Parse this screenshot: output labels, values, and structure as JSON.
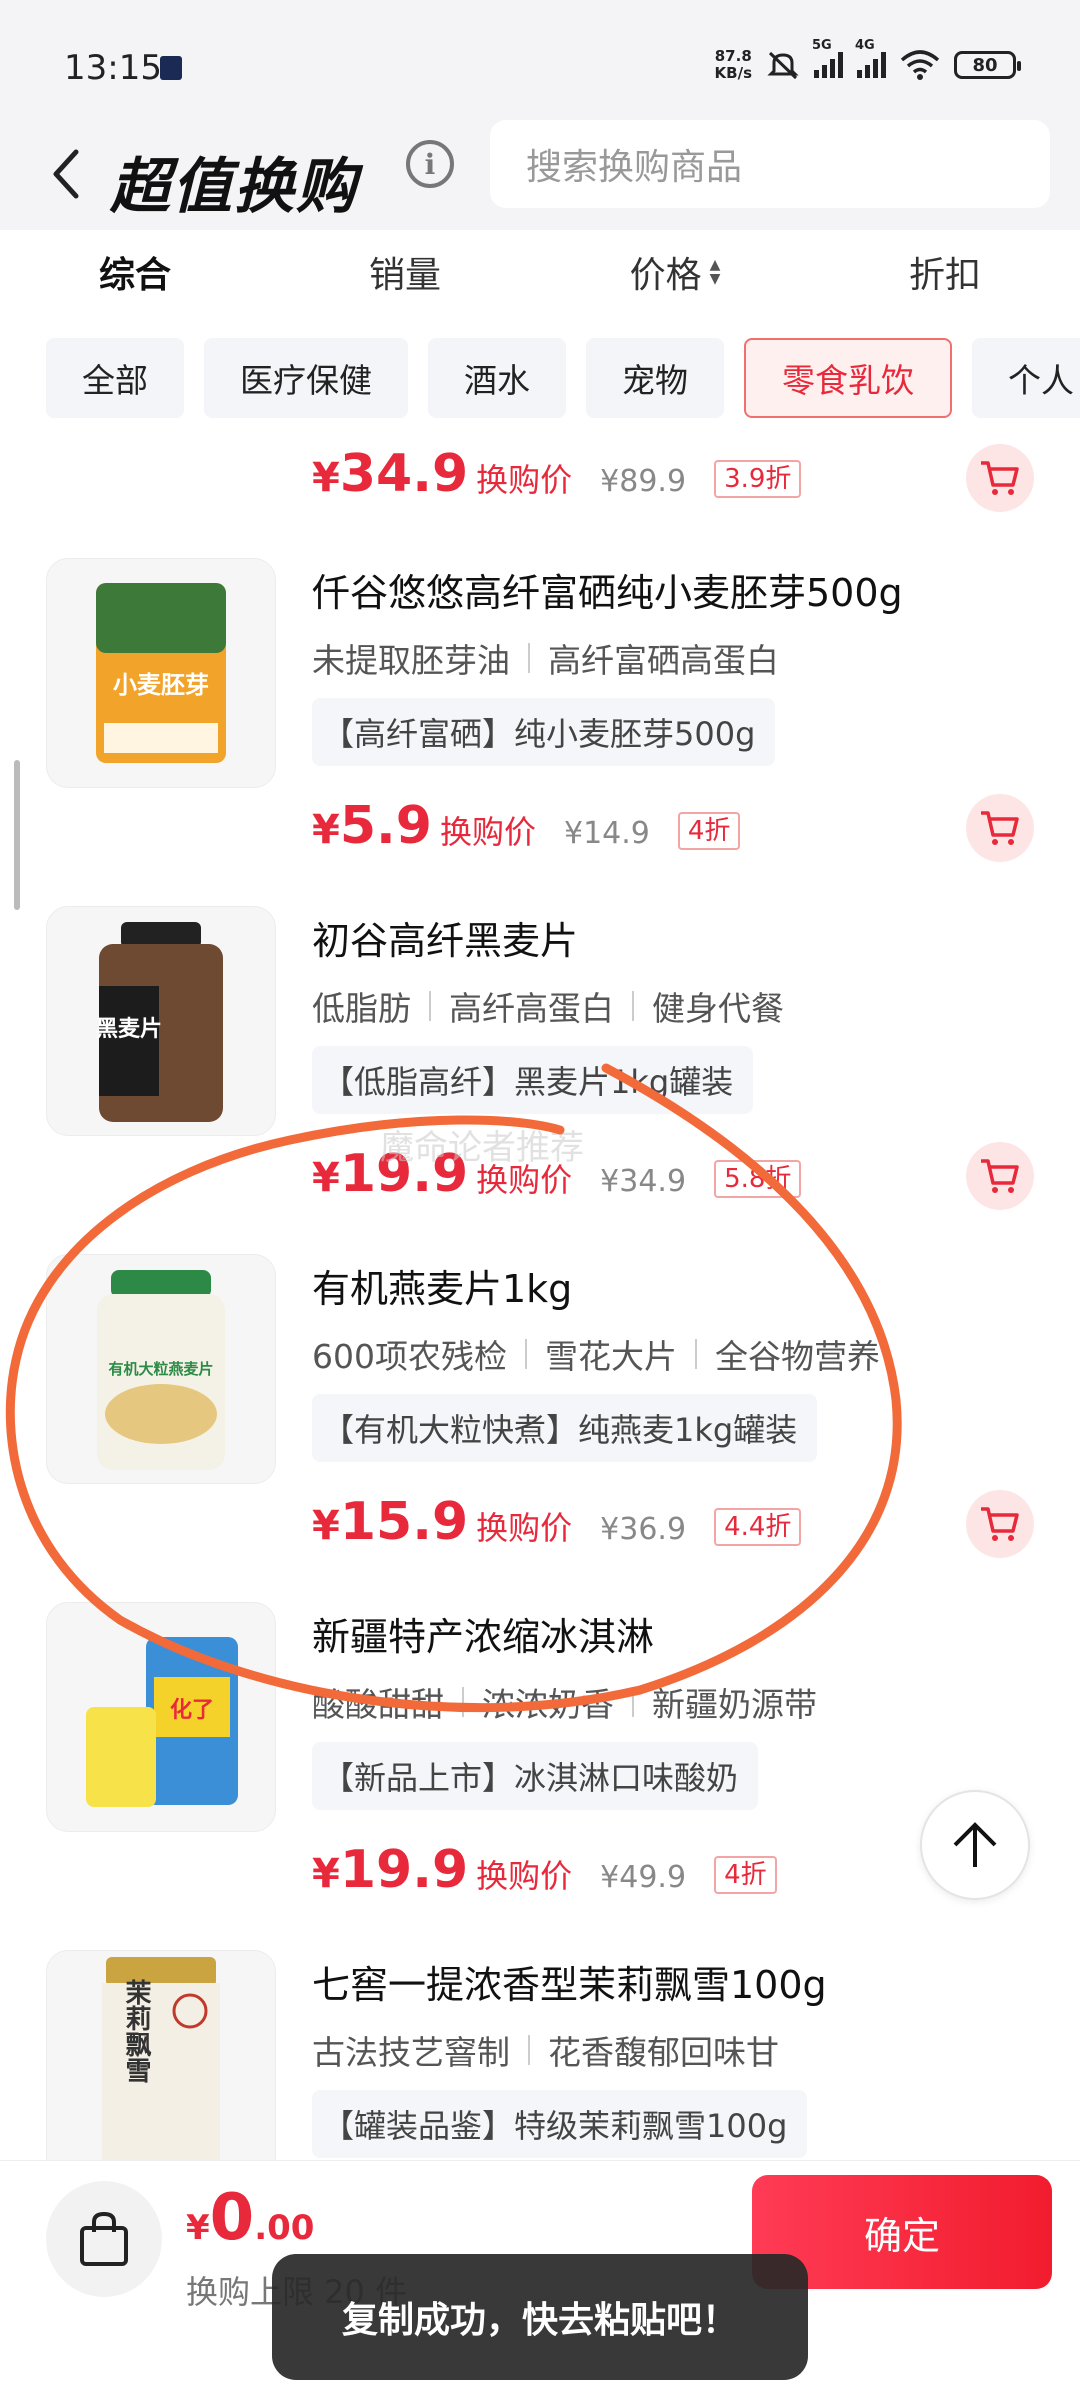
{
  "status_bar": {
    "time": "13:15",
    "net_speed_value": "87.8",
    "net_speed_unit": "KB/s",
    "sig1_tag": "5G",
    "sig2_tag": "4G",
    "battery": "80"
  },
  "header": {
    "title": "超值换购",
    "search_placeholder": "搜索换购商品"
  },
  "sort": [
    {
      "label": "综合",
      "active": true
    },
    {
      "label": "销量",
      "active": false
    },
    {
      "label": "价格",
      "active": false
    },
    {
      "label": "折扣",
      "active": false
    }
  ],
  "categories": [
    {
      "label": "全部",
      "active": false
    },
    {
      "label": "医疗保健",
      "active": false
    },
    {
      "label": "酒水",
      "active": false
    },
    {
      "label": "宠物",
      "active": false
    },
    {
      "label": "零食乳饮",
      "active": true
    },
    {
      "label": "个人",
      "active": false
    }
  ],
  "first_price": {
    "symbol": "¥",
    "price": "34.9",
    "label": "换购价",
    "original": "¥89.9",
    "discount": "3.9折"
  },
  "products": [
    {
      "name": "仟谷悠悠高纤富硒纯小麦胚芽500g",
      "tags": [
        "未提取胚芽油",
        "高纤富硒高蛋白"
      ],
      "promo": "【高纤富硒】纯小麦胚芽500g",
      "symbol": "¥",
      "price": "5.9",
      "price_label": "换购价",
      "original": "¥14.9",
      "discount": "4折",
      "thumb_text": "小麦胚芽"
    },
    {
      "name": "初谷高纤黑麦片",
      "tags": [
        "低脂肪",
        "高纤高蛋白",
        "健身代餐"
      ],
      "promo": "【低脂高纤】黑麦片1kg罐装",
      "symbol": "¥",
      "price": "19.9",
      "price_label": "换购价",
      "original": "¥34.9",
      "discount": "5.8折",
      "thumb_text": "黑麦片"
    },
    {
      "name": "有机燕麦片1kg",
      "tags": [
        "600项农残检",
        "雪花大片",
        "全谷物营养"
      ],
      "promo": "【有机大粒快煮】纯燕麦1kg罐装",
      "symbol": "¥",
      "price": "15.9",
      "price_label": "换购价",
      "original": "¥36.9",
      "discount": "4.4折",
      "thumb_text": "有机大粒燕麦片"
    },
    {
      "name": "新疆特产浓缩冰淇淋",
      "tags": [
        "酸酸甜甜",
        "浓浓奶香",
        "新疆奶源带"
      ],
      "promo": "【新品上市】冰淇淋口味酸奶",
      "symbol": "¥",
      "price": "19.9",
      "price_label": "换购价",
      "original": "¥49.9",
      "discount": "4折",
      "thumb_text": "化了"
    },
    {
      "name": "七窖一提浓香型茉莉飘雪100g",
      "tags": [
        "古法技艺窨制",
        "花香馥郁回味甘"
      ],
      "promo": "【罐装品鉴】特级茉莉飘雪100g",
      "symbol": "¥",
      "price": "",
      "price_label": "",
      "original": "",
      "discount": "",
      "thumb_text": "茉莉飘雪"
    }
  ],
  "watermark": "魔命论者推荐",
  "bottom": {
    "symbol": "¥",
    "total_int": "0",
    "total_dec": ".00",
    "limit_text": "换购上限 20 件",
    "confirm_label": "确定"
  },
  "toast": "复制成功，快去粘贴吧！",
  "colors": {
    "accent": "#e8293b",
    "annotation": "#f26a3a"
  }
}
